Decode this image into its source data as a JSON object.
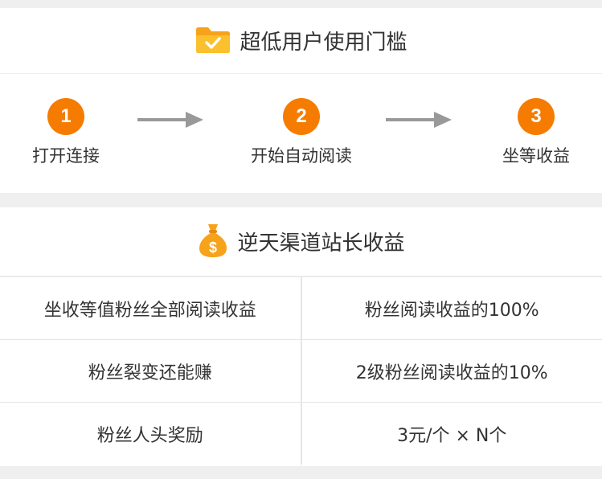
{
  "section1": {
    "title": "超低用户使用门槛",
    "icon": "folder-check-icon",
    "steps": [
      {
        "number": "1",
        "label": "打开连接"
      },
      {
        "number": "2",
        "label": "开始自动阅读"
      },
      {
        "number": "3",
        "label": "坐等收益"
      }
    ]
  },
  "section2": {
    "title": "逆天渠道站长收益",
    "icon": "money-bag-icon",
    "rows": [
      {
        "item": "坐收等值粉丝全部阅读收益",
        "value": "粉丝阅读收益的100%"
      },
      {
        "item": "粉丝裂变还能赚",
        "value": "2级粉丝阅读收益的10%"
      },
      {
        "item": "粉丝人头奖励",
        "value": "3元/个 × N个"
      }
    ]
  },
  "colors": {
    "accent": "#f57c00",
    "arrow": "#999999",
    "background": "#efefef"
  }
}
